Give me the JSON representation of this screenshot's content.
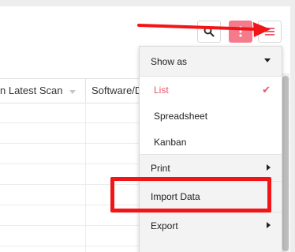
{
  "toolbar": {
    "search_icon": "search-icon",
    "more_icon": "vertical-dots-icon",
    "menu_icon": "hamburger-icon",
    "accent_color": "#f57a8c"
  },
  "table": {
    "columns": [
      "n Latest Scan",
      "Software/D"
    ]
  },
  "menu": {
    "show_as_label": "Show as",
    "view_options": [
      {
        "label": "List",
        "selected": true
      },
      {
        "label": "Spreadsheet",
        "selected": false
      },
      {
        "label": "Kanban",
        "selected": false
      }
    ],
    "print_label": "Print",
    "import_label": "Import Data",
    "export_label": "Export",
    "selected_color": "#e8546a"
  },
  "annotation": {
    "color": "#f21518"
  }
}
